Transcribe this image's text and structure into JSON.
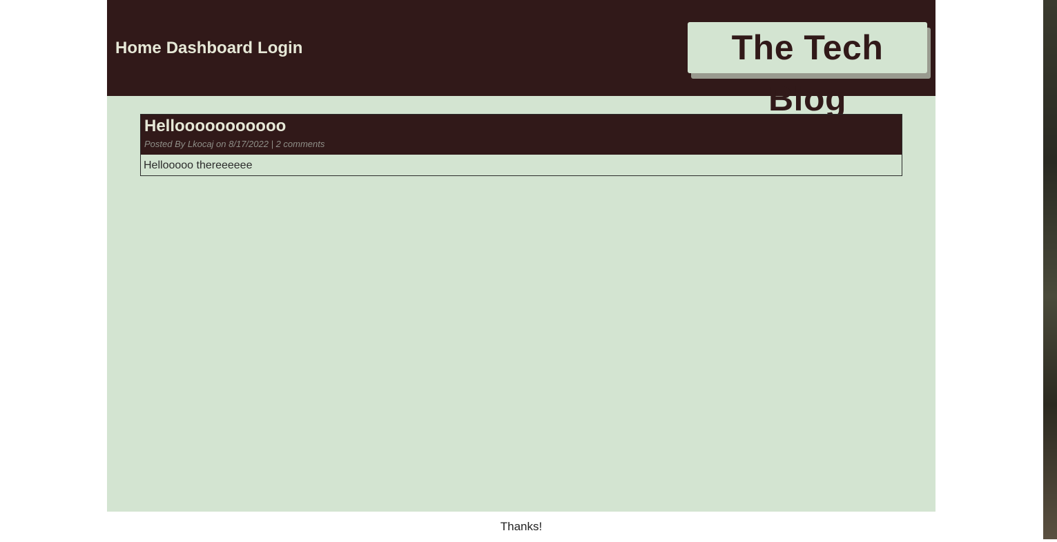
{
  "nav": {
    "items": [
      {
        "label": "Home"
      },
      {
        "label": "Dashboard"
      },
      {
        "label": "Login"
      }
    ]
  },
  "brand": {
    "title": "The Tech Blog"
  },
  "posts": [
    {
      "title": "Hellooooooooooo",
      "meta": "Posted By Lkocaj on 8/17/2022 | 2 comments",
      "body": "Hellooooo thereeeeee"
    }
  ],
  "footer": {
    "text": "Thanks!"
  },
  "colors": {
    "header_bg": "#311919",
    "page_bg": "#d3e4d1",
    "nav_text": "#e6e8d7"
  }
}
